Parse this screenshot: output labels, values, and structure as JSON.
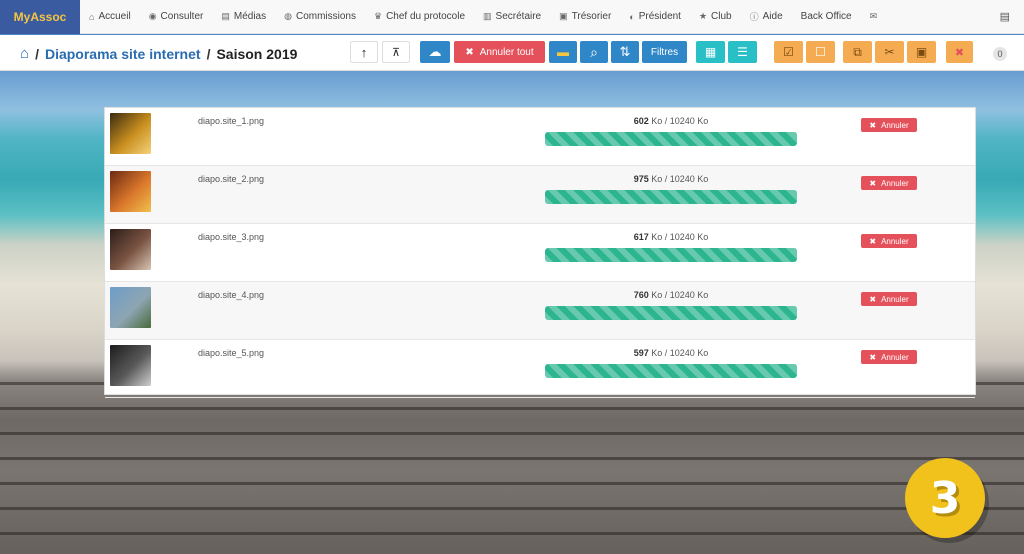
{
  "nav": {
    "brand": "MyAssoc",
    "items": [
      {
        "icon": "home-icon",
        "glyph": "⌂",
        "label": "Accueil"
      },
      {
        "icon": "eye-icon",
        "glyph": "◉",
        "label": "Consulter"
      },
      {
        "icon": "file-icon",
        "glyph": "▤",
        "label": "Médias"
      },
      {
        "icon": "users-icon",
        "glyph": "◍",
        "label": "Commissions"
      },
      {
        "icon": "trophy-icon",
        "glyph": "♛",
        "label": "Chef du protocole"
      },
      {
        "icon": "book-icon",
        "glyph": "▥",
        "label": "Secrétaire"
      },
      {
        "icon": "money-icon",
        "glyph": "▣",
        "label": "Trésorier"
      },
      {
        "icon": "globe-icon",
        "glyph": "◐",
        "label": "Président"
      },
      {
        "icon": "star-icon",
        "glyph": "★",
        "label": "Club"
      },
      {
        "icon": "info-icon",
        "glyph": "ⓘ",
        "label": "Aide"
      },
      {
        "icon": "",
        "glyph": "",
        "label": "Back Office"
      },
      {
        "icon": "envelope-icon",
        "glyph": "✉",
        "label": ""
      }
    ],
    "right_icon_glyph": "▤"
  },
  "breadcrumb": {
    "home_glyph": "⌂",
    "sep": "/",
    "link": "Diaporama site internet",
    "current": "Saison 2019"
  },
  "toolbar": {
    "up_glyph": "↑",
    "tree_glyph": "⊼",
    "upload_glyph": "☁",
    "cancel_all_glyph": "✖",
    "cancel_all_label": "Annuler tout",
    "folder_glyph": "▬",
    "search_glyph": "⌕",
    "sort_glyph": "⇅",
    "filters_label": "Filtres",
    "grid_glyph": "▦",
    "list_glyph": "☰",
    "check_glyph": "☑",
    "uncheck_glyph": "☐",
    "copy_glyph": "⧉",
    "cut_glyph": "✂",
    "paste_glyph": "▣",
    "delete_glyph": "✖",
    "count": "0"
  },
  "uploads": {
    "cancel_label": "Annuler",
    "cancel_glyph": "✖",
    "max_size": "10240 Ko",
    "items": [
      {
        "name": "diapo.site_1.png",
        "size_value": "602",
        "size_unit": "Ko",
        "progress": 100,
        "thumb": [
          "#3a2c10",
          "#c98f1f",
          "#f4d27a"
        ]
      },
      {
        "name": "diapo.site_2.png",
        "size_value": "975",
        "size_unit": "Ko",
        "progress": 100,
        "thumb": [
          "#6b2a12",
          "#d9762b",
          "#f1c04d"
        ]
      },
      {
        "name": "diapo.site_3.png",
        "size_value": "617",
        "size_unit": "Ko",
        "progress": 100,
        "thumb": [
          "#2c1d17",
          "#7b5443",
          "#d8c4b3"
        ]
      },
      {
        "name": "diapo.site_4.png",
        "size_value": "760",
        "size_unit": "Ko",
        "progress": 100,
        "thumb": [
          "#6e9dc9",
          "#8da5b3",
          "#4a6b3b"
        ]
      },
      {
        "name": "diapo.site_5.png",
        "size_value": "597",
        "size_unit": "Ko",
        "progress": 100,
        "thumb": [
          "#1c1c1c",
          "#5a5a5a",
          "#cfcfcf"
        ]
      }
    ]
  },
  "step_badge": "3",
  "colors": {
    "brand_bg": "#3a5ba0",
    "brand_text": "#f5c542",
    "primary": "#2f87c8",
    "danger": "#e5515b",
    "info": "#29bfc6",
    "warning": "#f5ab52",
    "progress": "#2cb58f",
    "badge": "#f1c21b"
  }
}
